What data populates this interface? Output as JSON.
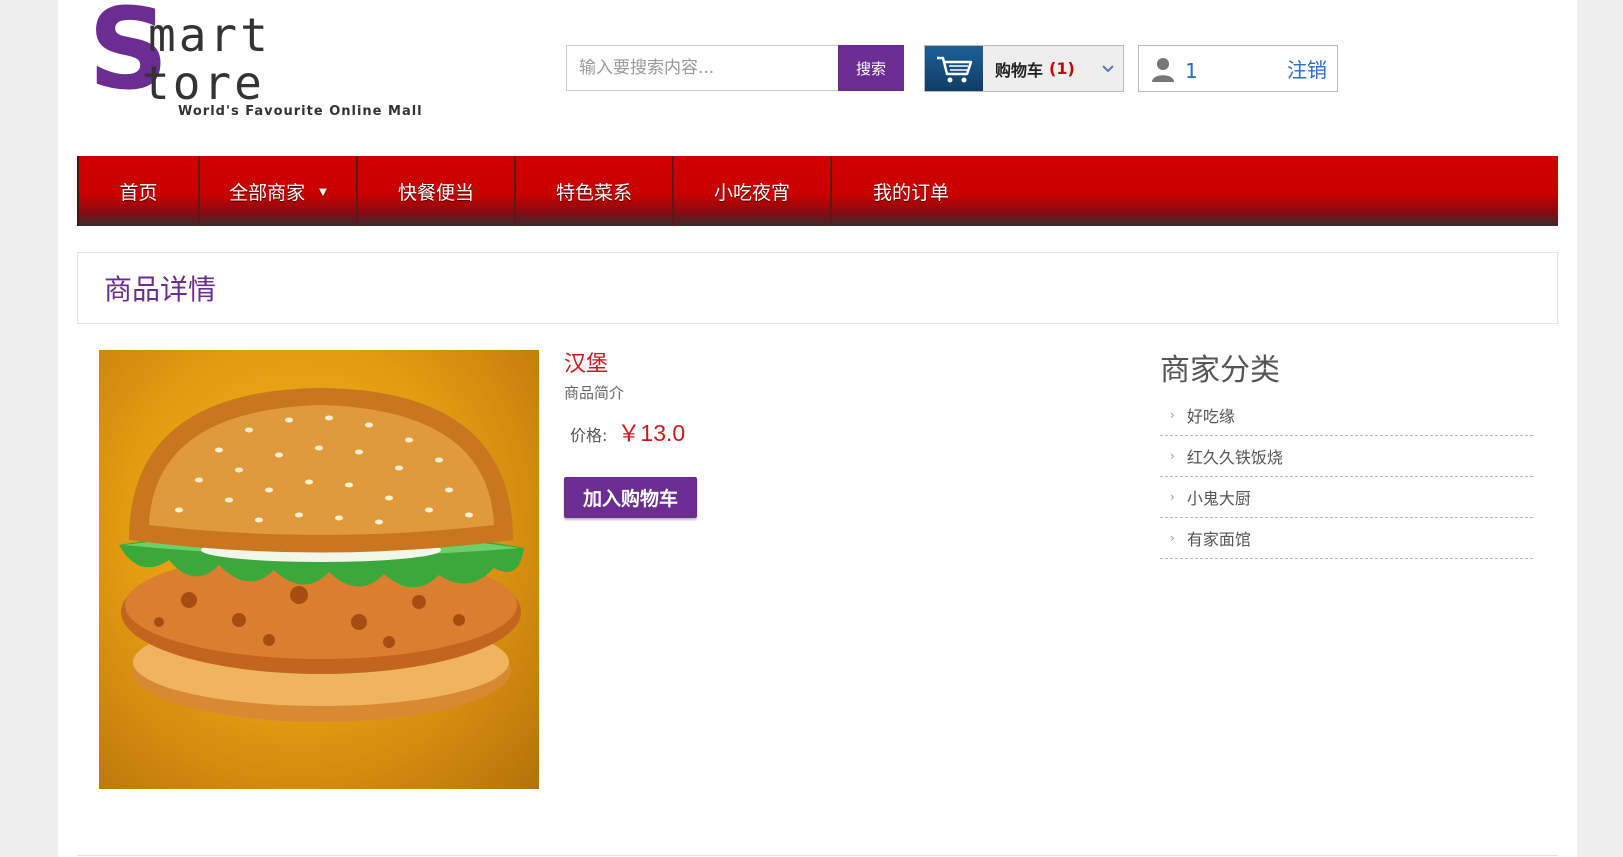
{
  "header": {
    "logo_mark": "S",
    "logo_word_1": "mart",
    "logo_word_2": "tore",
    "logo_tagline": "World's Favourite Online Mall",
    "search_placeholder": "输入要搜索内容...",
    "search_button": "搜索",
    "cart_label": "购物车",
    "cart_count": "(1)",
    "user_id": "1",
    "logout_label": "注销"
  },
  "nav": {
    "items": [
      {
        "label": "首页"
      },
      {
        "label": "全部商家"
      },
      {
        "label": "快餐便当"
      },
      {
        "label": "特色菜系"
      },
      {
        "label": "小吃夜宵"
      },
      {
        "label": "我的订单"
      }
    ]
  },
  "page": {
    "section_title": "商品详情"
  },
  "product": {
    "name": "汉堡",
    "description": "商品简介",
    "price_label": "价格:",
    "price_value": "￥13.0",
    "add_to_cart": "加入购物车"
  },
  "categories": {
    "title": "商家分类",
    "items": [
      {
        "label": "好吃缘"
      },
      {
        "label": "红久久铁饭烧"
      },
      {
        "label": "小鬼大厨"
      },
      {
        "label": "有家面馆"
      }
    ]
  },
  "colors": {
    "brand_purple": "#6b2d91",
    "nav_red": "#cc0000",
    "price_red": "#d0181c",
    "link_blue": "#2a6cc7"
  },
  "icons": {
    "cart": "shopping-cart-icon",
    "user": "user-icon",
    "dropdown": "chevron-down-icon",
    "list_arrow": "chevron-right-icon"
  }
}
